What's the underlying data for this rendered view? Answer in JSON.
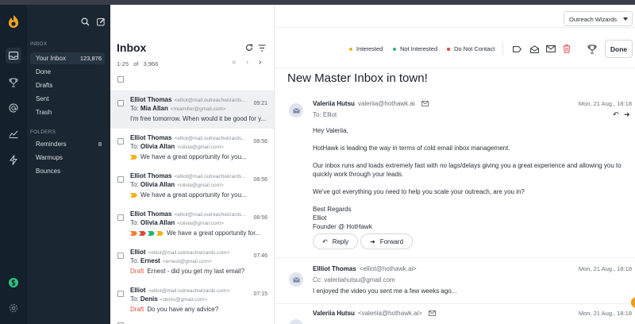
{
  "sidebar": {
    "inbox_section": "INBOX",
    "folders_section": "FOLDERS",
    "items": [
      {
        "label": "Your Inbox",
        "count": "123,876"
      },
      {
        "label": "Done",
        "count": ""
      },
      {
        "label": "Drafts",
        "count": ""
      },
      {
        "label": "Sent",
        "count": ""
      },
      {
        "label": "Trash",
        "count": ""
      }
    ],
    "folders": [
      {
        "label": "Reminders",
        "count": "8"
      },
      {
        "label": "Warmups",
        "count": ""
      },
      {
        "label": "Bounces",
        "count": ""
      }
    ]
  },
  "list": {
    "title": "Inbox",
    "range": "1-25",
    "of": "of",
    "total": "3,966",
    "messages": [
      {
        "from": "Elliot Thomas",
        "from_addr": "<elliot@mail.outreachwizards...",
        "to_prefix": "To:",
        "to": "Mia Allan",
        "to_addr": "<miamiller@gmail.com>",
        "time": "09:21",
        "snippet": "I'm free tomorrow. When would it be good for y...",
        "draft": ""
      },
      {
        "from": "Elliot Thomas",
        "from_addr": "<elliot@mail.outreachwizards...",
        "to_prefix": "To:",
        "to": "Olivia Allan",
        "to_addr": "<olivia@gmail.com>",
        "time": "08:56",
        "snippet": "We have a great opportunity for you...",
        "draft": ""
      },
      {
        "from": "Elliot Thomas",
        "from_addr": "<elliot@mail.outreachwizards...",
        "to_prefix": "To:",
        "to": "Olivia Allan",
        "to_addr": "<olivia@gmail.com>",
        "time": "08:56",
        "snippet": "We have a great opportunity for you...",
        "draft": ""
      },
      {
        "from": "Elliot Thomas",
        "from_addr": "<elliot@mail.outreachwizards...",
        "to_prefix": "To:",
        "to": "Olivia Allan",
        "to_addr": "<olivia@gmail.com>",
        "time": "08:56",
        "snippet": "We have a great opportunity for...",
        "draft": ""
      },
      {
        "from": "Elliot",
        "from_addr": "<elliot@mail.outreachwizards.com>",
        "to_prefix": "To:",
        "to": "Ernest",
        "to_addr": "<ernest@gmail.com>",
        "time": "07:46",
        "snippet": "Ernest - did you get my last email?",
        "draft": "Draft"
      },
      {
        "from": "Elliot",
        "from_addr": "<elliot@mail.outreachwizards.com>",
        "to_prefix": "To:",
        "to": "Denis",
        "to_addr": "<denis@gmail.com>",
        "time": "07:15",
        "snippet": "Do you have any advice?",
        "draft": "Draft"
      }
    ]
  },
  "toolbar": {
    "workspace": "Outreach Wizards",
    "status_interested": "Interested",
    "status_not_interested": "Not Interested",
    "status_do_not_contact": "Do Not Contact",
    "done_label": "Done",
    "colors": {
      "interested": "#f2b21b",
      "not_interested": "#22b573",
      "do_not_contact": "#e2463a",
      "trash": "#e5535a"
    }
  },
  "reader": {
    "subject": "New Master Inbox in town!",
    "email1": {
      "sender": "Valeriia Hutsu",
      "sender_addr": "valeriia@hothawk.ai",
      "to": "To:  Elliot",
      "date": "Mon, 21 Aug., 18:18",
      "greeting": "Hey Valeriia,",
      "p1": "HotHawk is leading the way in terms of cold email inbox management.",
      "p2": "Our inbox runs and loads extremely fast with no lags/delays giving you a great experience and allowing you to quickly work through your leads.",
      "p3": "We've got everything you need to help you scale your outreach, are you in?",
      "sig1": "Best Regards",
      "sig2": "Elliot",
      "sig3": "Founder @ HotHawk",
      "reply": "Reply",
      "forward": "Forward"
    },
    "email2": {
      "sender": "Ellliot Thomas",
      "sender_addr": "<elliot@hothawk.ai>",
      "cc": "Cc:  valeriiahutsu@gmail.com",
      "date": "Mon, 21 Aug., 18:18",
      "snippet": "I enjoyed the video you sent me a few weeks ago..."
    },
    "email3": {
      "sender": "Valeriia Hutsu",
      "sender_addr": "<valeriia@hothawk.ai>",
      "date": "Mon, 21 Aug., 18:18"
    }
  }
}
